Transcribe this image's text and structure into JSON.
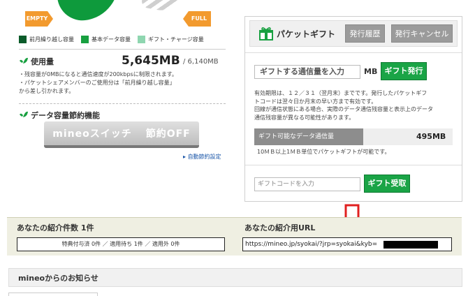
{
  "gauge": {
    "empty_label": "EMPTY",
    "full_label": "FULL",
    "colors": {
      "carryover": "#0b5b2a",
      "basic": "#18a040",
      "gift": "#8fd6b0"
    }
  },
  "legend": [
    {
      "label": "前月繰り越し容量",
      "color": "#0b5b2a"
    },
    {
      "label": "基本データ容量",
      "color": "#18a040"
    },
    {
      "label": "ギフト・チャージ容量",
      "color": "#8fd6b0"
    }
  ],
  "usage": {
    "heading": "使用量",
    "value": "5,645MB",
    "total": "/ 6,140MB",
    "notes": [
      "・残容量が0MBになると通信速度が200kbpsに制限されます。",
      "・パケットシェアメンバーのご使用分は「前月繰り越し容量」",
      "から差し引かれます。"
    ]
  },
  "saving": {
    "heading": "データ容量節約機能",
    "switch_brand": "mineoスイッチ",
    "switch_state": "節約OFF",
    "settings_link": "自動節約設定"
  },
  "gift": {
    "title": "パケットギフト",
    "history_button": "発行履歴",
    "cancel_button": "発行キャンセル",
    "amount_placeholder": "ギフトする通信量を入力",
    "unit": "MB",
    "issue_button": "ギフト発行",
    "note_lines": [
      "有効期限は、１２／３１（翌月末）までです。発行したパケットギフ",
      "トコードは翌々日か月末の早い方まで有効です。",
      "回線が通信状態にある場合、実際のデータ通信残容量と表示上のデータ",
      "通信残容量が異なる可能性があります。"
    ],
    "available_label": "ギフト可能なデータ通信量",
    "available_value": "495MB",
    "unit_note": "10ＭＢ以上1ＭＢ単位でパケットギフトが可能です。",
    "code_placeholder": "ギフトコードを入力",
    "receive_button": "ギフト受取"
  },
  "referral": {
    "count_title": "あなたの紹介件数 1件",
    "count_detail": "特典付与済 0件 ／ 適用待ち 1件 ／ 適用外 0件",
    "url_title": "あなたの紹介用URL",
    "url_value": "https://mineo.jp/syokai/?jrp=syokai&kyb=",
    "arrow_color": "#e02020"
  },
  "news": {
    "title": "mineoからのお知らせ"
  }
}
